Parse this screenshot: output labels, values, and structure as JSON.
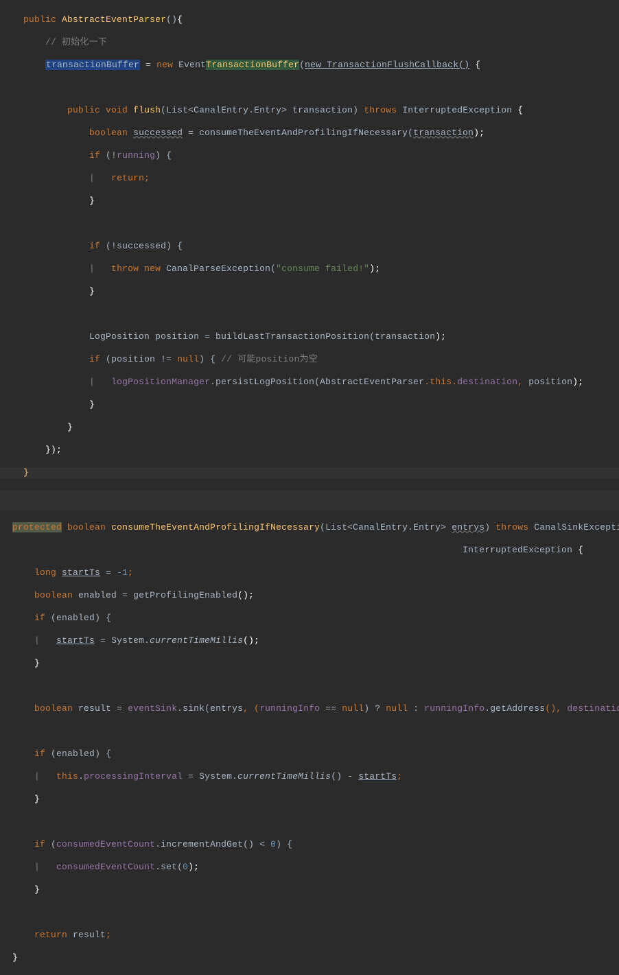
{
  "l1": {
    "public": "public",
    "name": "AbstractEventParser",
    "paren": "()",
    "brace": "{"
  },
  "l2": {
    "comment": "// 初始化一下"
  },
  "l3": {
    "var": "transactionBuffer",
    "eq": " = ",
    "newkw": "new",
    "sp": " ",
    "cls1": "Event",
    "cls2": "TransactionBuffer",
    "open": "(",
    "arg": "new TransactionFlushCallback()",
    "sp2": " ",
    "brace": "{"
  },
  "l5": {
    "public": "public",
    "void": "void",
    "method": "flush",
    "open": "(",
    "type": "List<CanalEntry.Entry>",
    "sp": " ",
    "param": "transaction",
    "close": ") ",
    "throws": "throws",
    "sp2": " ",
    "exc": "InterruptedException",
    "brace": " {"
  },
  "l6": {
    "type": "boolean",
    "sp": " ",
    "var": "successed",
    "eq": " = ",
    "method": "consumeTheEventAndProfilingIfNecessary",
    "open": "(",
    "arg": "transaction",
    "close": ");"
  },
  "l7": {
    "if": "if",
    "open": " (!",
    "var": "running",
    "close": ") {"
  },
  "l8": {
    "ret": "return;"
  },
  "l9": {
    "brace": "}"
  },
  "l11": {
    "if": "if",
    "open": " (!",
    "var": "successed",
    "close": ") {"
  },
  "l12": {
    "throw": "throw",
    "sp": " ",
    "new": "new",
    "sp2": " ",
    "cls": "CanalParseException",
    "open": "(",
    "str": "\"consume failed!\"",
    "close": ");"
  },
  "l13": {
    "brace": "}"
  },
  "l15": {
    "type": "LogPosition",
    "sp": " ",
    "var": "position",
    "eq": " = ",
    "method": "buildLastTransactionPosition",
    "open": "(",
    "arg": "transaction",
    "close": ");"
  },
  "l16": {
    "if": "if",
    "open": " (",
    "var": "position",
    "neq": " != ",
    "null": "null",
    "close": ") { ",
    "comment": "// 可能position为空"
  },
  "l17": {
    "var": "logPositionManager",
    "dot": ".",
    "method": "persistLogPosition",
    "open": "(",
    "cls": "AbstractEventParser",
    "this": ".this.",
    "dest": "destination",
    "comma": ", ",
    "pos": "position",
    "close": ");"
  },
  "l18": {
    "brace": "}"
  },
  "l19": {
    "brace": "}"
  },
  "l20": {
    "brace": "});"
  },
  "l21": {
    "brace": "}"
  },
  "m1": {
    "prot": "protected",
    "sp": " ",
    "bool": "boolean",
    "sp2": " ",
    "method": "consumeTheEventAndProfilingIfNecessary",
    "open": "(",
    "type": "List<CanalEntry.Entry>",
    "sp3": " ",
    "param": "entrys",
    "close": ") ",
    "throws": "throws",
    "sp4": " ",
    "exc1": "CanalSinkException",
    "comma": ","
  },
  "m1b": {
    "exc2": "InterruptedException",
    "brace": " {"
  },
  "m2": {
    "type": "long",
    "sp": " ",
    "var": "startTs",
    "eq": " = ",
    "val": "-1",
    "semi": ";"
  },
  "m3": {
    "type": "boolean",
    "sp": " ",
    "var": "enabled",
    "eq": " = ",
    "method": "getProfilingEnabled",
    "close": "();"
  },
  "m4": {
    "if": "if",
    "open": " (",
    "var": "enabled",
    "close": ") {"
  },
  "m5": {
    "var": "startTs",
    "eq": " = ",
    "cls": "System",
    "dot": ".",
    "method": "currentTimeMillis",
    "close": "();"
  },
  "m6": {
    "brace": "}"
  },
  "m8": {
    "type": "boolean",
    "sp": " ",
    "var": "result",
    "eq": " = ",
    "sink": "eventSink",
    "dot": ".",
    "method": "sink",
    "open": "(",
    "arg1": "entrys",
    "c1": ", (",
    "arg2": "runningInfo",
    "eqq": " == ",
    "null": "null",
    "q1": ") ? ",
    "null2": "null",
    "q2": " : ",
    "r2": "runningInfo",
    "d2": ".",
    "getaddr": "getAddress",
    "pc": "(), ",
    "dest": "destination",
    "close": ");"
  },
  "m10": {
    "if": "if",
    "open": " (",
    "var": "enabled",
    "close": ") {"
  },
  "m11": {
    "this": "this",
    "dot": ".",
    "field": "processingInterval",
    "eq": " = ",
    "cls": "System",
    "d2": ".",
    "method": "currentTimeMillis",
    "pc": "() - ",
    "var": "startTs",
    "semi": ";"
  },
  "m12": {
    "brace": "}"
  },
  "m14": {
    "if": "if",
    "open": " (",
    "var": "consumedEventCount",
    "dot": ".",
    "method": "incrementAndGet",
    "pc": "() < ",
    "zero": "0",
    "close": ") {"
  },
  "m15": {
    "var": "consumedEventCount",
    "dot": ".",
    "method": "set",
    "open": "(",
    "zero": "0",
    "close": ");"
  },
  "m16": {
    "brace": "}"
  },
  "m18": {
    "ret": "return",
    "sp": " ",
    "var": "result",
    "semi": ";"
  },
  "m19": {
    "brace": "}"
  }
}
